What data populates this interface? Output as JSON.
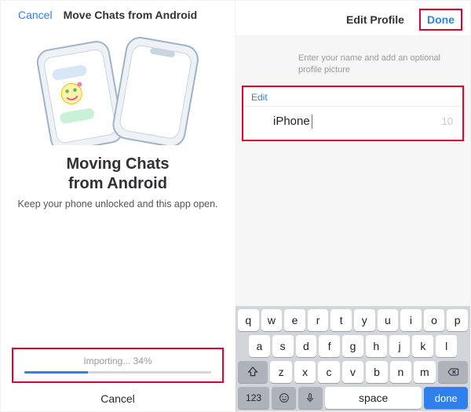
{
  "left": {
    "header": {
      "cancel": "Cancel",
      "title": "Move Chats from Android"
    },
    "headline": "Moving Chats\nfrom Android",
    "subline": "Keep your phone unlocked and this app open.",
    "progress": {
      "label": "Importing... 34%",
      "percent": 34
    },
    "bottomCancel": "Cancel"
  },
  "right": {
    "header": {
      "title": "Edit Profile",
      "done": "Done"
    },
    "hint": "Enter your name and add an optional profile picture",
    "editLabel": "Edit",
    "nameValue": "iPhone",
    "nameCount": "10"
  },
  "keyboard": {
    "row1": [
      "q",
      "w",
      "e",
      "r",
      "t",
      "y",
      "u",
      "i",
      "o",
      "p"
    ],
    "row2": [
      "a",
      "s",
      "d",
      "f",
      "g",
      "h",
      "j",
      "k",
      "l"
    ],
    "row3": [
      "z",
      "x",
      "c",
      "v",
      "b",
      "n",
      "m"
    ],
    "shift": "⇧",
    "backspace": "⌫",
    "numKey": "123",
    "space": "space",
    "doneKey": "done"
  }
}
